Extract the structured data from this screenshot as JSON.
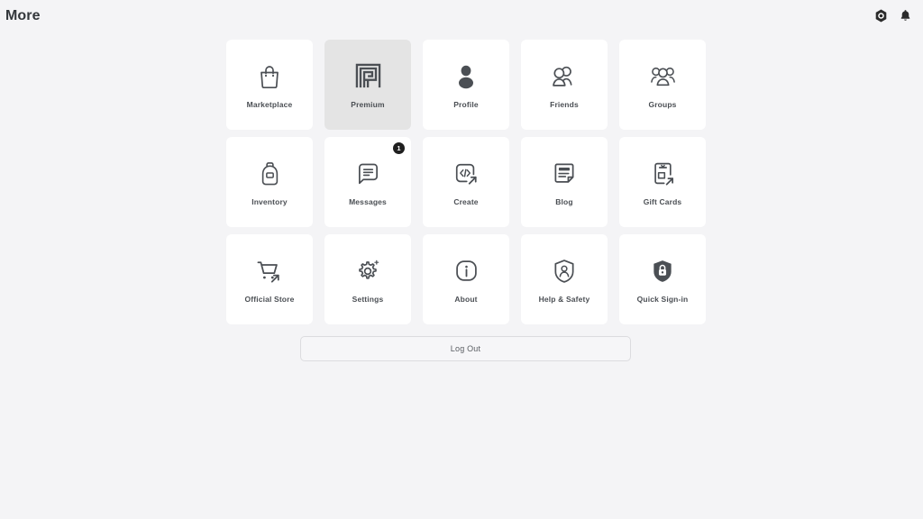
{
  "header": {
    "title": "More",
    "icons": [
      {
        "name": "robux-currency-icon",
        "glyph": "hexagon"
      },
      {
        "name": "notification-bell-icon",
        "glyph": "bell"
      }
    ]
  },
  "grid": {
    "tiles": [
      {
        "label": "Marketplace",
        "icon": "shopping-bag-icon",
        "selected": false,
        "badge": null
      },
      {
        "label": "Premium",
        "icon": "premium-spiral-icon",
        "selected": true,
        "badge": null
      },
      {
        "label": "Profile",
        "icon": "person-filled-icon",
        "selected": false,
        "badge": null
      },
      {
        "label": "Friends",
        "icon": "two-people-icon",
        "selected": false,
        "badge": null
      },
      {
        "label": "Groups",
        "icon": "three-people-icon",
        "selected": false,
        "badge": null
      },
      {
        "label": "Inventory",
        "icon": "backpack-icon",
        "selected": false,
        "badge": null
      },
      {
        "label": "Messages",
        "icon": "message-document-icon",
        "selected": false,
        "badge": "1"
      },
      {
        "label": "Create",
        "icon": "code-external-link-icon",
        "selected": false,
        "badge": null
      },
      {
        "label": "Blog",
        "icon": "blog-page-icon",
        "selected": false,
        "badge": null
      },
      {
        "label": "Gift Cards",
        "icon": "gift-card-external-icon",
        "selected": false,
        "badge": null
      },
      {
        "label": "Official Store",
        "icon": "shopping-cart-external-icon",
        "selected": false,
        "badge": null
      },
      {
        "label": "Settings",
        "icon": "gear-sparkle-icon",
        "selected": false,
        "badge": null
      },
      {
        "label": "About",
        "icon": "info-circle-icon",
        "selected": false,
        "badge": null
      },
      {
        "label": "Help & Safety",
        "icon": "shield-person-icon",
        "selected": false,
        "badge": null
      },
      {
        "label": "Quick Sign-in",
        "icon": "shield-lock-filled-icon",
        "selected": false,
        "badge": null
      }
    ]
  },
  "footer": {
    "logout_label": "Log Out"
  },
  "colors": {
    "page_background": "#f4f4f6",
    "tile_background": "#ffffff",
    "tile_selected_background": "#e4e4e4",
    "icon_stroke": "#4b4f54",
    "label_text": "#4b4f54",
    "badge_background": "#1f1f1f",
    "title_text": "#33373b"
  }
}
